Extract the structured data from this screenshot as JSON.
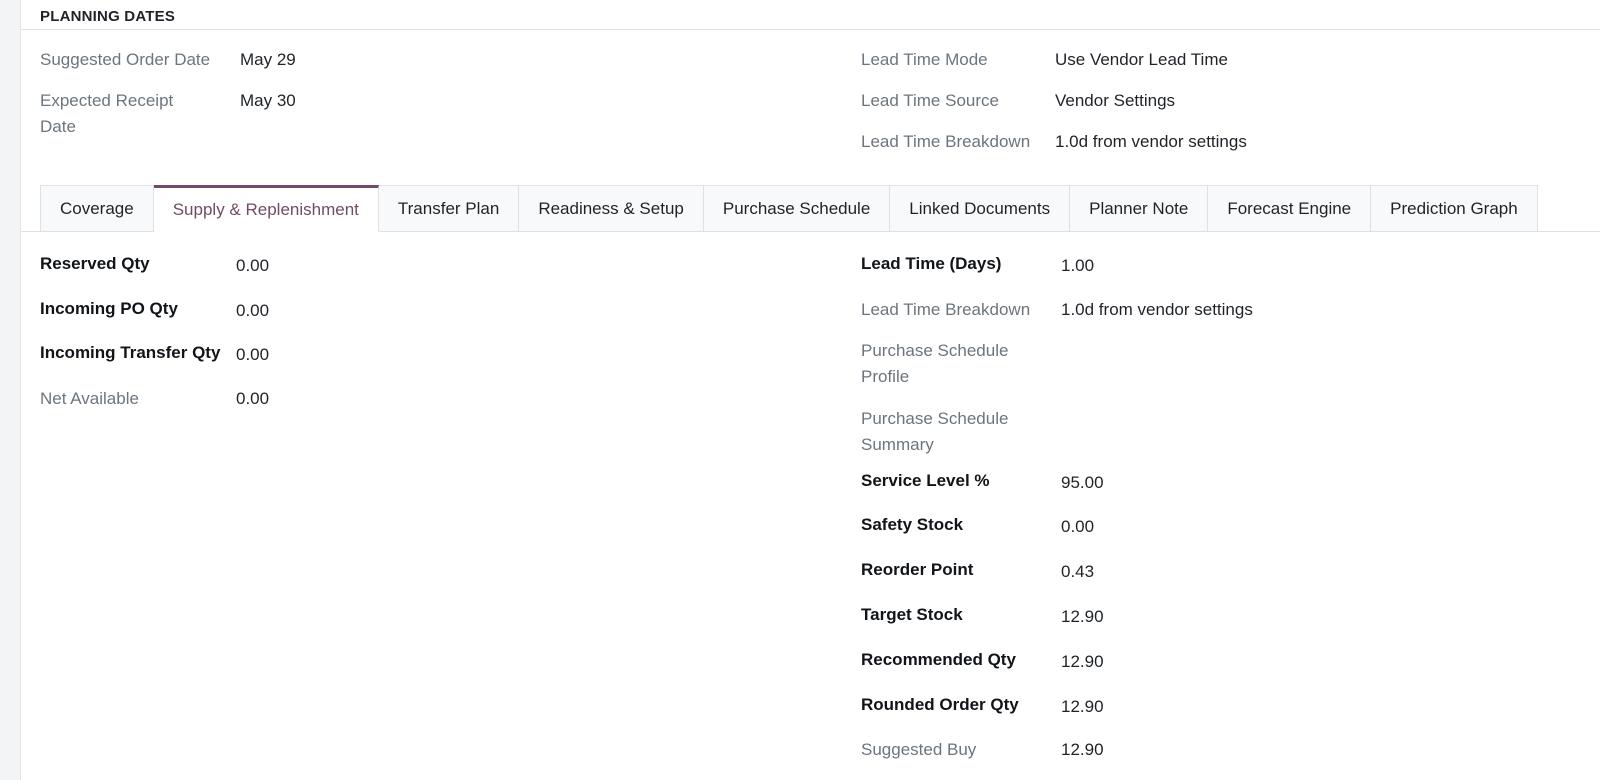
{
  "planning": {
    "title": "PLANNING DATES",
    "suggested_order_date": {
      "label": "Suggested Order Date",
      "value": "May 29"
    },
    "expected_receipt_date": {
      "label": "Expected Receipt Date",
      "value": "May 30"
    },
    "lead_time_mode": {
      "label": "Lead Time Mode",
      "value": "Use Vendor Lead Time"
    },
    "lead_time_source": {
      "label": "Lead Time Source",
      "value": "Vendor Settings"
    },
    "lead_time_breakdown": {
      "label": "Lead Time Breakdown",
      "value": "1.0d from vendor settings"
    }
  },
  "tabs": [
    {
      "label": "Coverage"
    },
    {
      "label": "Supply & Replenishment",
      "active": true
    },
    {
      "label": "Transfer Plan"
    },
    {
      "label": "Readiness & Setup"
    },
    {
      "label": "Purchase Schedule"
    },
    {
      "label": "Linked Documents"
    },
    {
      "label": "Planner Note"
    },
    {
      "label": "Forecast Engine"
    },
    {
      "label": "Prediction Graph"
    }
  ],
  "supply": {
    "left": [
      {
        "label": "Reserved Qty",
        "value": "0.00"
      },
      {
        "label": "Incoming PO Qty",
        "value": "0.00"
      },
      {
        "label": "Incoming Transfer Qty",
        "value": "0.00"
      },
      {
        "label": "Net Available",
        "value": "0.00"
      }
    ],
    "right": [
      {
        "label": "Lead Time (Days)",
        "value": "1.00"
      },
      {
        "label": "Lead Time Breakdown",
        "value": "1.0d from vendor settings"
      },
      {
        "label": "Purchase Schedule Profile",
        "value": ""
      },
      {
        "label": "Purchase Schedule Summary",
        "value": ""
      },
      {
        "label": "Service Level %",
        "value": "95.00"
      },
      {
        "label": "Safety Stock",
        "value": "0.00"
      },
      {
        "label": "Reorder Point",
        "value": "0.43"
      },
      {
        "label": "Target Stock",
        "value": "12.90"
      },
      {
        "label": "Recommended Qty",
        "value": "12.90"
      },
      {
        "label": "Rounded Order Qty",
        "value": "12.90"
      },
      {
        "label": "Suggested Buy",
        "value": "12.90"
      }
    ]
  },
  "colors": {
    "accent": "#714b67",
    "muted_label": "#6c757d",
    "border": "#dee2e6"
  }
}
